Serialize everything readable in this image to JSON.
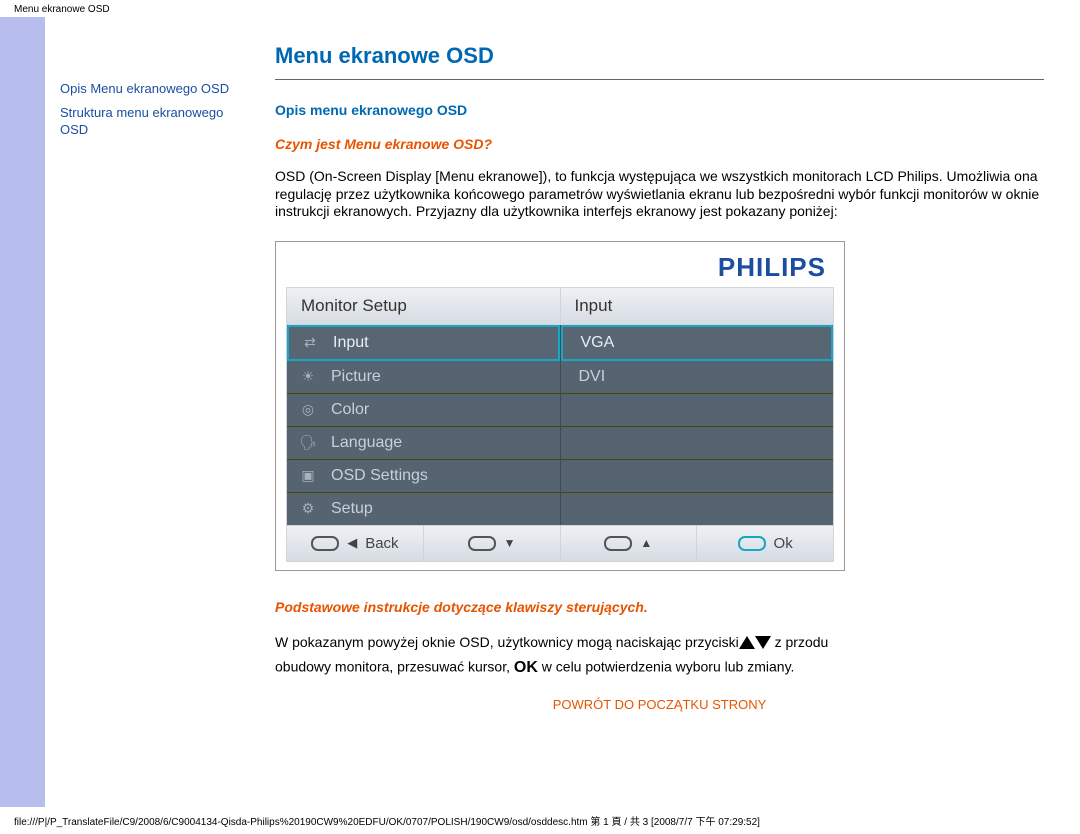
{
  "page_header": "Menu ekranowe OSD",
  "sidebar": {
    "link1": "Opis Menu ekranowego OSD",
    "link2": "Struktura menu ekranowego OSD"
  },
  "title": "Menu ekranowe OSD",
  "section1_heading": "Opis menu ekranowego OSD",
  "section1_sub": "Czym jest Menu ekranowe OSD?",
  "section1_body": "OSD (On-Screen Display [Menu ekranowe]), to funkcja występująca we wszystkich monitorach LCD Philips. Umożliwia ona regulację przez użytkownika końcowego parametrów wyświetlania ekranu lub bezpośredni wybór funkcji monitorów w oknie instrukcji ekranowych. Przyjazny dla użytkownika interfejs ekranowy jest pokazany poniżej:",
  "osd": {
    "brand": "PHILIPS",
    "col_left_title": "Monitor Setup",
    "col_right_title": "Input",
    "left_items": [
      {
        "icon": "⇄",
        "label": "Input",
        "selected": true
      },
      {
        "icon": "☀",
        "label": "Picture"
      },
      {
        "icon": "◎",
        "label": "Color"
      },
      {
        "icon": "🗣",
        "label": "Language"
      },
      {
        "icon": "▣",
        "label": "OSD Settings"
      },
      {
        "icon": "⚙",
        "label": "Setup"
      }
    ],
    "right_items": [
      {
        "label": "VGA",
        "selected": true
      },
      {
        "label": "DVI"
      }
    ],
    "btn_back": "Back",
    "btn_ok": "Ok"
  },
  "section2_sub": "Podstawowe instrukcje dotyczące klawiszy sterujących.",
  "section2_part1": "W pokazanym powyżej oknie OSD, użytkownicy mogą naciskając przyciski",
  "section2_part2": " z przodu",
  "section2_part3": "obudowy monitora, przesuwać kursor, ",
  "section2_part4": " w celu potwierdzenia wyboru lub zmiany.",
  "back_to_top": "POWRÓT DO POCZĄTKU STRONY",
  "footer": "file:///P|/P_TranslateFile/C9/2008/6/C9004134-Qisda-Philips%20190CW9%20EDFU/OK/0707/POLISH/190CW9/osd/osddesc.htm 第 1 頁 / 共 3  [2008/7/7 下午 07:29:52]"
}
